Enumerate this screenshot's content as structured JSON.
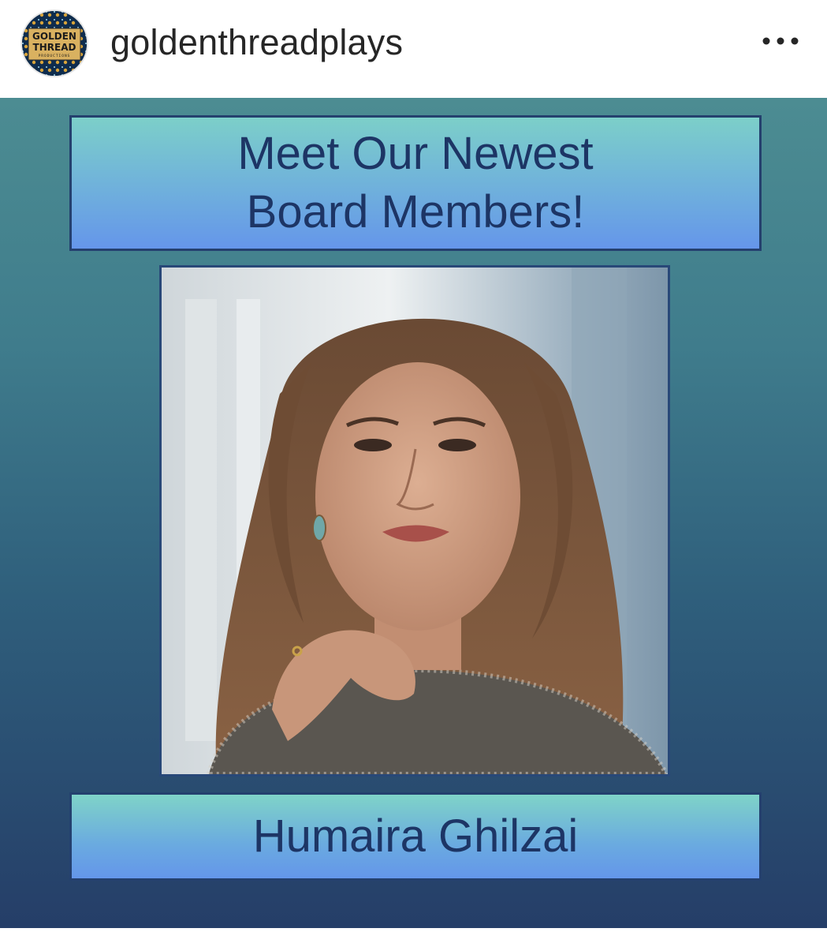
{
  "post_header": {
    "username": "goldenthreadplays",
    "avatar_logo_text": [
      "GOLDEN",
      "THREAD",
      "PRODUCTIONS"
    ],
    "more_icon": "more-horizontal-icon"
  },
  "post_image": {
    "title": "Meet Our Newest Board Members!",
    "photo_description_icon": "portrait-photo",
    "member_name": "Humaira Ghilzai"
  },
  "colors": {
    "text_dark": "#262626",
    "title_text": "#1d3565",
    "box_border": "#24406e",
    "bg_top": "#4c8c92",
    "bg_bottom": "#253e68"
  }
}
